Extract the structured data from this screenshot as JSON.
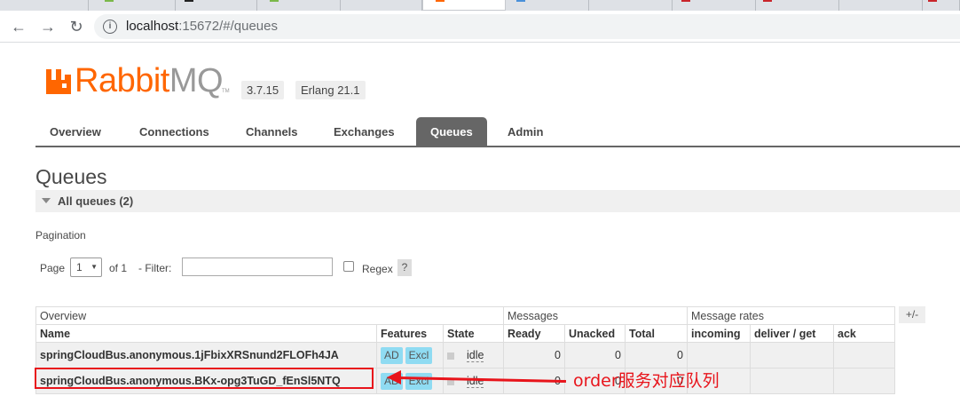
{
  "browser": {
    "url_host": "localhost",
    "url_rest": ":15672/#/queues"
  },
  "header": {
    "brand_rabbit": "Rabbit",
    "brand_mq": "MQ",
    "trademark": "TM",
    "version": "3.7.15",
    "erlang": "Erlang 21.1"
  },
  "nav": {
    "tabs": [
      "Overview",
      "Connections",
      "Channels",
      "Exchanges",
      "Queues",
      "Admin"
    ],
    "active": "Queues"
  },
  "page": {
    "title": "Queues",
    "section": "All queues (2)"
  },
  "pagination": {
    "label": "Pagination",
    "page_label": "Page",
    "page_value": "1",
    "of_label": "of 1",
    "filter_label": "- Filter:",
    "regex_label": "Regex",
    "help": "?"
  },
  "table": {
    "group_headers": [
      "Overview",
      "Messages",
      "Message rates"
    ],
    "columns": [
      "Name",
      "Features",
      "State",
      "Ready",
      "Unacked",
      "Total",
      "incoming",
      "deliver / get",
      "ack"
    ],
    "toggle_columns": "+/-",
    "rows": [
      {
        "name": "springCloudBus.anonymous.1jFbixXRSnund2FLOFh4JA",
        "features": [
          "AD",
          "Excl"
        ],
        "state": "idle",
        "ready": "0",
        "unacked": "0",
        "total": "0"
      },
      {
        "name": "springCloudBus.anonymous.BKx-opg3TuGD_fEnSl5NTQ",
        "features": [
          "AD",
          "Excl"
        ],
        "state": "idle",
        "ready": "0",
        "unacked": "0",
        "total": "0"
      }
    ]
  },
  "annotation": {
    "text": "order服务对应队列",
    "color": "#e8141b"
  },
  "colors": {
    "brand_orange": "#ff6600",
    "active_tab": "#666666",
    "feature_badge": "#8fdbf2"
  }
}
